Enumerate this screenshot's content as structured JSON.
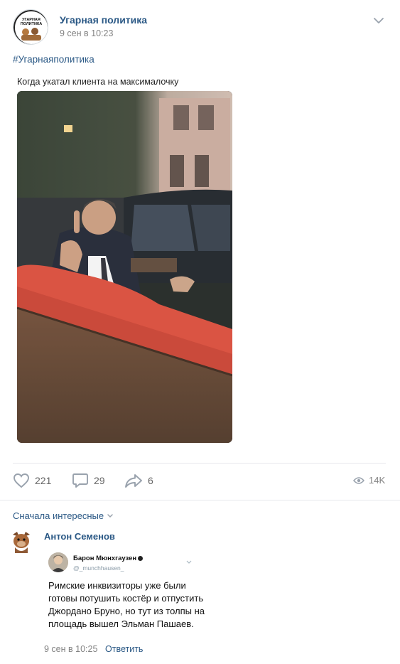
{
  "post": {
    "group_name": "Угарная политика",
    "time": "9 сен в 10:23",
    "hashtag": "#Угарнаяполитика",
    "caption": "Когда укатал клиента на максималочку",
    "avatar_text": "Угарная политика"
  },
  "actions": {
    "likes": "221",
    "comments": "29",
    "shares": "6",
    "views": "14K"
  },
  "comments": {
    "sort_label": "Сначала интересные",
    "items": [
      {
        "author": "Антон Семенов",
        "tweet": {
          "name": "Барон Мюнхгаузен",
          "handle": "@_munchhausen_",
          "text": "Римские инквизиторы уже были готовы потушить костёр и отпустить Джордано Бруно, но тут из толпы на площадь вышел Эльман Пашаев."
        },
        "time": "9 сен в 10:25",
        "reply_label": "Ответить"
      }
    ]
  },
  "colors": {
    "link": "#2a5885",
    "muted": "#828282",
    "icon": "#99a2ad"
  }
}
